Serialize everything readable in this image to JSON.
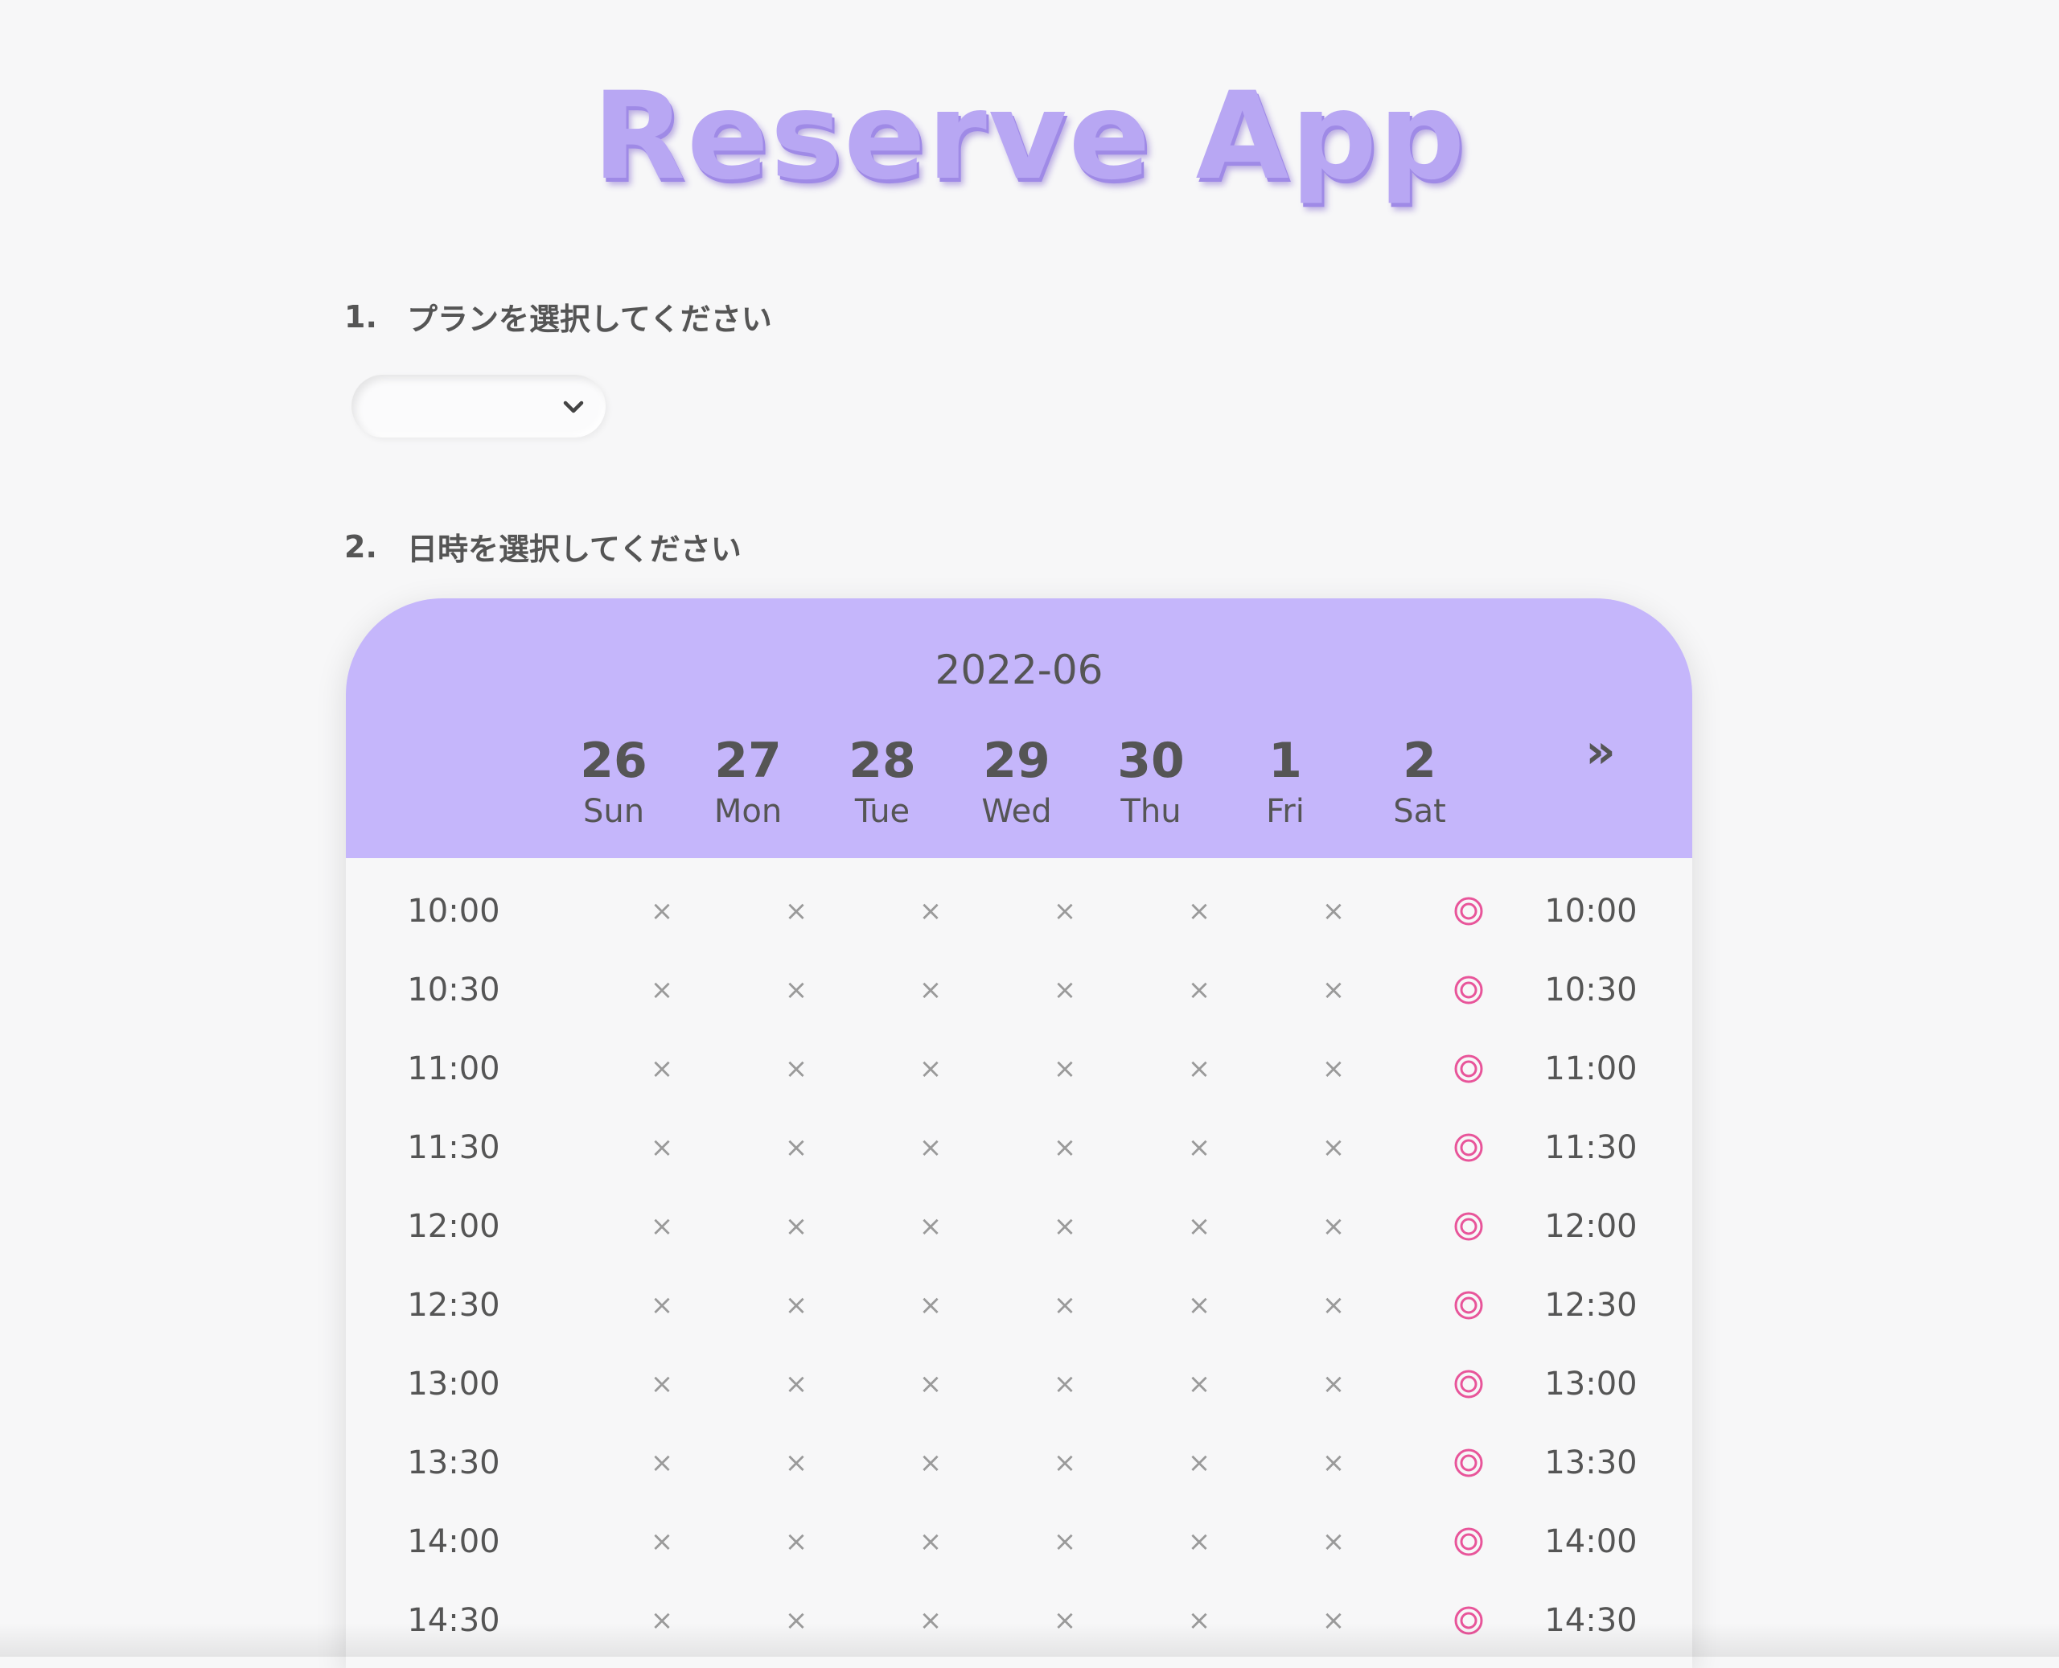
{
  "app": {
    "title": "Reserve App"
  },
  "step1": {
    "number": "1.",
    "label": "プランを選択してください",
    "selected_value": ""
  },
  "step2": {
    "number": "2.",
    "label": "日時を選択してください"
  },
  "calendar": {
    "month": "2022-06",
    "next_label": "»",
    "days": [
      {
        "num": "26",
        "weekday": "Sun"
      },
      {
        "num": "27",
        "weekday": "Mon"
      },
      {
        "num": "28",
        "weekday": "Tue"
      },
      {
        "num": "29",
        "weekday": "Wed"
      },
      {
        "num": "30",
        "weekday": "Thu"
      },
      {
        "num": "1",
        "weekday": "Fri"
      },
      {
        "num": "2",
        "weekday": "Sat"
      }
    ],
    "unavailable_symbol": "×",
    "available_color": "#e8559a",
    "rows": [
      {
        "time": "10:00",
        "slots": [
          "×",
          "×",
          "×",
          "×",
          "×",
          "×",
          "◎"
        ]
      },
      {
        "time": "10:30",
        "slots": [
          "×",
          "×",
          "×",
          "×",
          "×",
          "×",
          "◎"
        ]
      },
      {
        "time": "11:00",
        "slots": [
          "×",
          "×",
          "×",
          "×",
          "×",
          "×",
          "◎"
        ]
      },
      {
        "time": "11:30",
        "slots": [
          "×",
          "×",
          "×",
          "×",
          "×",
          "×",
          "◎"
        ]
      },
      {
        "time": "12:00",
        "slots": [
          "×",
          "×",
          "×",
          "×",
          "×",
          "×",
          "◎"
        ]
      },
      {
        "time": "12:30",
        "slots": [
          "×",
          "×",
          "×",
          "×",
          "×",
          "×",
          "◎"
        ]
      },
      {
        "time": "13:00",
        "slots": [
          "×",
          "×",
          "×",
          "×",
          "×",
          "×",
          "◎"
        ]
      },
      {
        "time": "13:30",
        "slots": [
          "×",
          "×",
          "×",
          "×",
          "×",
          "×",
          "◎"
        ]
      },
      {
        "time": "14:00",
        "slots": [
          "×",
          "×",
          "×",
          "×",
          "×",
          "×",
          "◎"
        ]
      },
      {
        "time": "14:30",
        "slots": [
          "×",
          "×",
          "×",
          "×",
          "×",
          "×",
          "◎"
        ]
      }
    ]
  },
  "icons": {
    "dropdown": "chevron-down-icon",
    "available": "double-circle-icon",
    "unavailable": "cross-icon"
  }
}
